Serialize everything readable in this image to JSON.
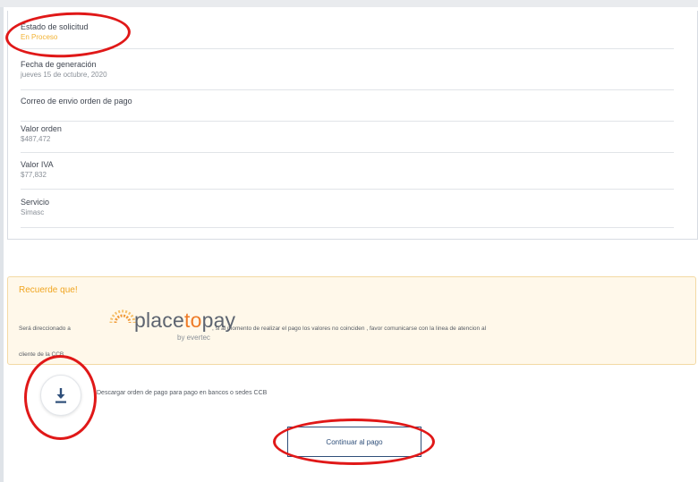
{
  "details": [
    {
      "label": "Estado de solicitud",
      "value": "En Proceso"
    },
    {
      "label": "Fecha de generación",
      "value": "jueves 15 de octubre, 2020"
    },
    {
      "label": "Correo de envio orden de pago",
      "value": ""
    },
    {
      "label": "Valor orden",
      "value": "$487,472"
    },
    {
      "label": "Valor IVA",
      "value": "$77,832"
    },
    {
      "label": "Servicio",
      "value": "Simasc"
    }
  ],
  "notice": {
    "title": "Recuerde que!",
    "text_before": "Será direccionado a",
    "text_after": ", si al momento de realizar el pago los valores no coinciden , favor comunicarse con la linea de atencion al",
    "text_line2": "cliente de la CCB",
    "logo_word_a": "place",
    "logo_word_b": "to",
    "logo_word_c": "pay",
    "logo_by": "by evertec"
  },
  "download": {
    "icon": "download-icon",
    "label": "Descargar orden de pago para pago en bancos o sedes CCB"
  },
  "continue_button": {
    "label": "Continuar al pago"
  },
  "colors": {
    "status": "#f2b233",
    "accent": "#f0a520",
    "button": "#2f4f7a",
    "annotation": "#e01818"
  }
}
